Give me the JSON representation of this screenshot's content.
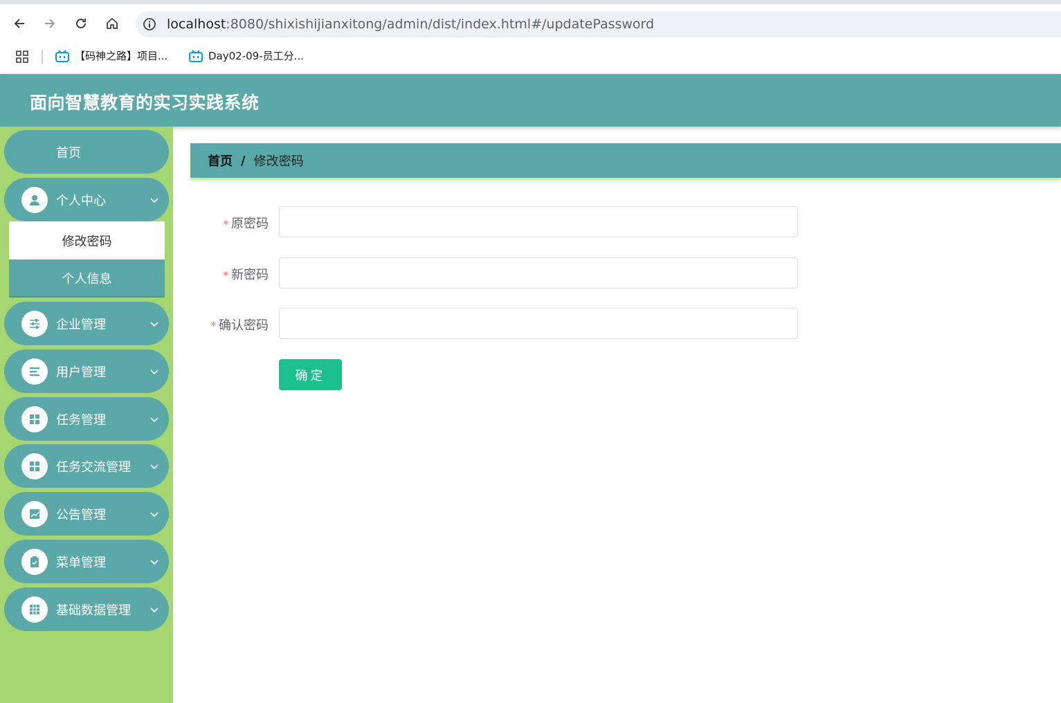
{
  "browser": {
    "url_host": "localhost",
    "url_path": ":8080/shixishijianxitong/admin/dist/index.html#/updatePassword",
    "bookmarks": [
      {
        "label": "【码神之路】项目..."
      },
      {
        "label": "Day02-09-员工分..."
      }
    ]
  },
  "app": {
    "title": "面向智慧教育的实习实践系统"
  },
  "sidebar": {
    "home": "首页",
    "personal_center": "个人中心",
    "submenu": {
      "change_password": "修改密码",
      "personal_info": "个人信息"
    },
    "items": [
      {
        "label": "企业管理",
        "icon": "sliders-icon"
      },
      {
        "label": "用户管理",
        "icon": "list-icon"
      },
      {
        "label": "任务管理",
        "icon": "grid-icon"
      },
      {
        "label": "任务交流管理",
        "icon": "grid-icon"
      },
      {
        "label": "公告管理",
        "icon": "chart-icon"
      },
      {
        "label": "菜单管理",
        "icon": "clipboard-check-icon"
      },
      {
        "label": "基础数据管理",
        "icon": "table-grid-icon"
      }
    ]
  },
  "breadcrumb": {
    "home": "首页",
    "separator": "/",
    "current": "修改密码"
  },
  "form": {
    "required_mark": "*",
    "old_password_label": "原密码",
    "old_password_value": "",
    "new_password_label": "新密码",
    "new_password_value": "",
    "confirm_password_label": "确认密码",
    "confirm_password_value": "",
    "submit_label": "确定"
  },
  "colors": {
    "header_bg": "#5aa8a8",
    "sidebar_bg": "#a6d672",
    "submit_bg": "#1cc08f",
    "required_star": "#f56c6c"
  }
}
